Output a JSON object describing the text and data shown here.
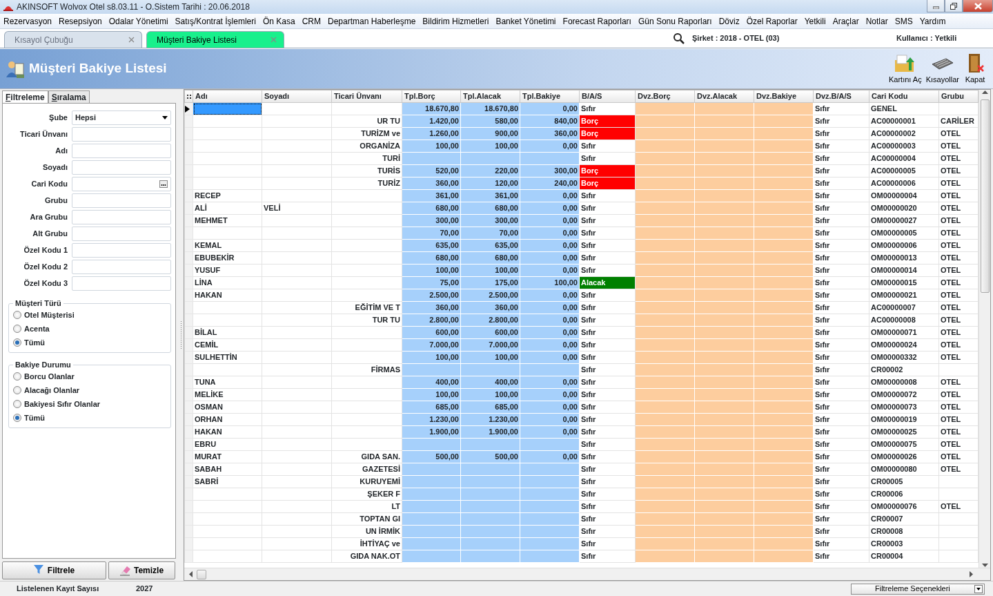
{
  "window": {
    "title": "AKINSOFT Wolvox Otel s8.03.11 - O.Sistem Tarihi : 20.06.2018"
  },
  "menu": [
    "Rezervasyon",
    "Resepsiyon",
    "Odalar Yönetimi",
    "Satış/Kontrat İşlemleri",
    "Ön Kasa",
    "CRM",
    "Departman Haberleşme",
    "Bildirim Hizmetleri",
    "Banket Yönetimi",
    "Forecast Raporları",
    "Gün Sonu Raporları",
    "Döviz",
    "Özel Raporlar",
    "Yetkili",
    "Araçlar",
    "Notlar",
    "SMS",
    "Yardım"
  ],
  "tabs": [
    {
      "label": "Kısayol Çubuğu",
      "selected": false
    },
    {
      "label": "Müşteri Bakiye Listesi",
      "selected": true
    }
  ],
  "company": "Şirket : 2018 - OTEL (03)",
  "user": "Kullanıcı : Yetkili",
  "page_title": "Müşteri Bakiye Listesi",
  "toolbar": [
    {
      "label": "Kartını Aç",
      "kind": "open"
    },
    {
      "label": "Kısayollar",
      "kind": "keyboard"
    },
    {
      "label": "Kapat",
      "kind": "close"
    }
  ],
  "filter_tabs": [
    {
      "label": "Filtreleme",
      "selected": true
    },
    {
      "label": "Sıralama",
      "selected": false
    }
  ],
  "filter_fields": [
    {
      "label": "Şube",
      "kind": "select",
      "value": "Hepsi"
    },
    {
      "label": "Ticari Ünvanı",
      "kind": "text"
    },
    {
      "label": "Adı",
      "kind": "text"
    },
    {
      "label": "Soyadı",
      "kind": "text"
    },
    {
      "label": "Cari Kodu",
      "kind": "lookup"
    },
    {
      "label": "Grubu",
      "kind": "text"
    },
    {
      "label": "Ara Grubu",
      "kind": "text"
    },
    {
      "label": "Alt Grubu",
      "kind": "text"
    },
    {
      "label": "Özel Kodu 1",
      "kind": "text"
    },
    {
      "label": "Özel Kodu 2",
      "kind": "text"
    },
    {
      "label": "Özel Kodu 3",
      "kind": "text"
    }
  ],
  "radio_groups": [
    {
      "title": "Müşteri Türü",
      "options": [
        {
          "label": "Otel Müşterisi",
          "selected": false
        },
        {
          "label": "Acenta",
          "selected": false
        },
        {
          "label": "Tümü",
          "selected": true
        }
      ]
    },
    {
      "title": "Bakiye Durumu",
      "options": [
        {
          "label": "Borcu Olanlar",
          "selected": false
        },
        {
          "label": "Alacağı Olanlar",
          "selected": false
        },
        {
          "label": "Bakiyesi Sıfır Olanlar",
          "selected": false
        },
        {
          "label": "Tümü",
          "selected": true
        }
      ]
    }
  ],
  "buttons": [
    {
      "label": "Filtrele",
      "kind": "filter"
    },
    {
      "label": "Temizle",
      "kind": "clear"
    }
  ],
  "table": {
    "columns": [
      "Adı",
      "Soyadı",
      "Ticari Ünvanı",
      "Tpl.Borç",
      "Tpl.Alacak",
      "Tpl.Bakiye",
      "B/A/S",
      "Dvz.Borç",
      "Dvz.Alacak",
      "Dvz.Bakiye",
      "Dvz.B/A/S",
      "Cari Kodu",
      "Grubu"
    ],
    "rows": [
      {
        "selected": true,
        "borc": "18.670,80",
        "alacak": "18.670,80",
        "bakiye": "0,00",
        "bas": "Sıfır",
        "dvz_bas": "Sıfır",
        "cari_kodu": "GENEL"
      },
      {
        "selected": false,
        "unvan": "UR TU",
        "borc": "1.420,00",
        "alacak": "580,00",
        "bakiye": "840,00",
        "bas": "Borç",
        "color": "#ff0000",
        "dvz_bas": "Sıfır",
        "cari_kodu": "AC00000001",
        "grubu": "CARİLER"
      },
      {
        "selected": false,
        "unvan": "TURİZM ve",
        "borc": "1.260,00",
        "alacak": "900,00",
        "bakiye": "360,00",
        "bas": "Borç",
        "color": "#ff0000",
        "dvz_bas": "Sıfır",
        "cari_kodu": "AC00000002",
        "grubu": "OTEL"
      },
      {
        "selected": false,
        "unvan": "ORGANİZA",
        "borc": "100,00",
        "alacak": "100,00",
        "bakiye": "0,00",
        "bas": "Sıfır",
        "dvz_bas": "Sıfır",
        "cari_kodu": "AC00000003",
        "grubu": "OTEL"
      },
      {
        "selected": false,
        "unvan": "TURİ",
        "bas": "Sıfır",
        "dvz_bas": "Sıfır",
        "cari_kodu": "AC00000004",
        "grubu": "OTEL"
      },
      {
        "selected": false,
        "unvan": "TURİS",
        "borc": "520,00",
        "alacak": "220,00",
        "bakiye": "300,00",
        "bas": "Borç",
        "color": "#ff0000",
        "dvz_bas": "Sıfır",
        "cari_kodu": "AC00000005",
        "grubu": "OTEL"
      },
      {
        "selected": false,
        "unvan": "TURİZ",
        "borc": "360,00",
        "alacak": "120,00",
        "bakiye": "240,00",
        "bas": "Borç",
        "color": "#ff0000",
        "dvz_bas": "Sıfır",
        "cari_kodu": "AC00000006",
        "grubu": "OTEL"
      },
      {
        "selected": false,
        "adi": "RECEP",
        "borc": "361,00",
        "alacak": "361,00",
        "bakiye": "0,00",
        "bas": "Sıfır",
        "dvz_bas": "Sıfır",
        "cari_kodu": "OM00000004",
        "grubu": "OTEL"
      },
      {
        "selected": false,
        "adi": "ALİ",
        "soyadi": "VELİ",
        "borc": "680,00",
        "alacak": "680,00",
        "bakiye": "0,00",
        "bas": "Sıfır",
        "dvz_bas": "Sıfır",
        "cari_kodu": "OM00000020",
        "grubu": "OTEL"
      },
      {
        "selected": false,
        "adi": "MEHMET",
        "borc": "300,00",
        "alacak": "300,00",
        "bakiye": "0,00",
        "bas": "Sıfır",
        "dvz_bas": "Sıfır",
        "cari_kodu": "OM00000027",
        "grubu": "OTEL"
      },
      {
        "selected": false,
        "borc": "70,00",
        "alacak": "70,00",
        "bakiye": "0,00",
        "bas": "Sıfır",
        "dvz_bas": "Sıfır",
        "cari_kodu": "OM00000005",
        "grubu": "OTEL"
      },
      {
        "selected": false,
        "adi": "KEMAL",
        "borc": "635,00",
        "alacak": "635,00",
        "bakiye": "0,00",
        "bas": "Sıfır",
        "dvz_bas": "Sıfır",
        "cari_kodu": "OM00000006",
        "grubu": "OTEL"
      },
      {
        "selected": false,
        "adi": "EBUBEKİR",
        "borc": "680,00",
        "alacak": "680,00",
        "bakiye": "0,00",
        "bas": "Sıfır",
        "dvz_bas": "Sıfır",
        "cari_kodu": "OM00000013",
        "grubu": "OTEL"
      },
      {
        "selected": false,
        "adi": "YUSUF",
        "borc": "100,00",
        "alacak": "100,00",
        "bakiye": "0,00",
        "bas": "Sıfır",
        "dvz_bas": "Sıfır",
        "cari_kodu": "OM00000014",
        "grubu": "OTEL"
      },
      {
        "selected": false,
        "adi": "LİNA",
        "borc": "75,00",
        "alacak": "175,00",
        "bakiye": "100,00",
        "bas": "Alacak",
        "color": "#008000",
        "dvz_bas": "Sıfır",
        "cari_kodu": "OM00000015",
        "grubu": "OTEL"
      },
      {
        "selected": false,
        "adi": "HAKAN",
        "borc": "2.500,00",
        "alacak": "2.500,00",
        "bakiye": "0,00",
        "bas": "Sıfır",
        "dvz_bas": "Sıfır",
        "cari_kodu": "OM00000021",
        "grubu": "OTEL"
      },
      {
        "selected": false,
        "unvan": "EĞİTİM VE T",
        "borc": "360,00",
        "alacak": "360,00",
        "bakiye": "0,00",
        "bas": "Sıfır",
        "dvz_bas": "Sıfır",
        "cari_kodu": "AC00000007",
        "grubu": "OTEL"
      },
      {
        "selected": false,
        "unvan": "TUR TU",
        "borc": "2.800,00",
        "alacak": "2.800,00",
        "bakiye": "0,00",
        "bas": "Sıfır",
        "dvz_bas": "Sıfır",
        "cari_kodu": "AC00000008",
        "grubu": "OTEL"
      },
      {
        "selected": false,
        "adi": "BİLAL",
        "borc": "600,00",
        "alacak": "600,00",
        "bakiye": "0,00",
        "bas": "Sıfır",
        "dvz_bas": "Sıfır",
        "cari_kodu": "OM00000071",
        "grubu": "OTEL"
      },
      {
        "selected": false,
        "adi": "CEMİL",
        "borc": "7.000,00",
        "alacak": "7.000,00",
        "bakiye": "0,00",
        "bas": "Sıfır",
        "dvz_bas": "Sıfır",
        "cari_kodu": "OM00000024",
        "grubu": "OTEL"
      },
      {
        "selected": false,
        "adi": "SULHETTİN",
        "borc": "100,00",
        "alacak": "100,00",
        "bakiye": "0,00",
        "bas": "Sıfır",
        "dvz_bas": "Sıfır",
        "cari_kodu": "OM00000332",
        "grubu": "OTEL"
      },
      {
        "selected": false,
        "unvan": "FİRMAS",
        "bas": "Sıfır",
        "dvz_bas": "Sıfır",
        "cari_kodu": "CR00002"
      },
      {
        "selected": false,
        "adi": "TUNA",
        "borc": "400,00",
        "alacak": "400,00",
        "bakiye": "0,00",
        "bas": "Sıfır",
        "dvz_bas": "Sıfır",
        "cari_kodu": "OM00000008",
        "grubu": "OTEL"
      },
      {
        "selected": false,
        "adi": "MELİKE",
        "borc": "100,00",
        "alacak": "100,00",
        "bakiye": "0,00",
        "bas": "Sıfır",
        "dvz_bas": "Sıfır",
        "cari_kodu": "OM00000072",
        "grubu": "OTEL"
      },
      {
        "selected": false,
        "adi": "OSMAN",
        "borc": "685,00",
        "alacak": "685,00",
        "bakiye": "0,00",
        "bas": "Sıfır",
        "dvz_bas": "Sıfır",
        "cari_kodu": "OM00000073",
        "grubu": "OTEL"
      },
      {
        "selected": false,
        "adi": "ORHAN",
        "borc": "1.230,00",
        "alacak": "1.230,00",
        "bakiye": "0,00",
        "bas": "Sıfır",
        "dvz_bas": "Sıfır",
        "cari_kodu": "OM00000019",
        "grubu": "OTEL"
      },
      {
        "selected": false,
        "adi": "HAKAN",
        "borc": "1.900,00",
        "alacak": "1.900,00",
        "bakiye": "0,00",
        "bas": "Sıfır",
        "dvz_bas": "Sıfır",
        "cari_kodu": "OM00000025",
        "grubu": "OTEL"
      },
      {
        "selected": false,
        "adi": "EBRU",
        "bas": "Sıfır",
        "dvz_bas": "Sıfır",
        "cari_kodu": "OM00000075",
        "grubu": "OTEL"
      },
      {
        "selected": false,
        "adi": "MURAT",
        "unvan": "GIDA SAN.",
        "borc": "500,00",
        "alacak": "500,00",
        "bakiye": "0,00",
        "bas": "Sıfır",
        "dvz_bas": "Sıfır",
        "cari_kodu": "OM00000026",
        "grubu": "OTEL"
      },
      {
        "selected": false,
        "adi": "SABAH",
        "unvan": "GAZETESİ",
        "bas": "Sıfır",
        "dvz_bas": "Sıfır",
        "cari_kodu": "OM00000080",
        "grubu": "OTEL"
      },
      {
        "selected": false,
        "adi": "SABRİ",
        "unvan": "KURUYEMİ",
        "bas": "Sıfır",
        "dvz_bas": "Sıfır",
        "cari_kodu": "CR00005"
      },
      {
        "selected": false,
        "unvan": "ŞEKER F",
        "bas": "Sıfır",
        "dvz_bas": "Sıfır",
        "cari_kodu": "CR00006"
      },
      {
        "selected": false,
        "unvan": "LT",
        "bas": "Sıfır",
        "dvz_bas": "Sıfır",
        "cari_kodu": "OM00000076",
        "grubu": "OTEL"
      },
      {
        "selected": false,
        "unvan": "TOPTAN GI",
        "bas": "Sıfır",
        "dvz_bas": "Sıfır",
        "cari_kodu": "CR00007"
      },
      {
        "selected": false,
        "unvan": "UN İRMİK",
        "bas": "Sıfır",
        "dvz_bas": "Sıfır",
        "cari_kodu": "CR00008"
      },
      {
        "selected": false,
        "unvan": "İHTİYAÇ ve",
        "bas": "Sıfır",
        "dvz_bas": "Sıfır",
        "cari_kodu": "CR00003"
      },
      {
        "selected": false,
        "unvan": "GIDA NAK.OT",
        "bas": "Sıfır",
        "dvz_bas": "Sıfır",
        "cari_kodu": "CR00004"
      }
    ]
  },
  "status_bar": {
    "label": "Listelenen Kayıt Sayısı",
    "count": "2027",
    "options_button": "Filtreleme Seçenekleri"
  }
}
